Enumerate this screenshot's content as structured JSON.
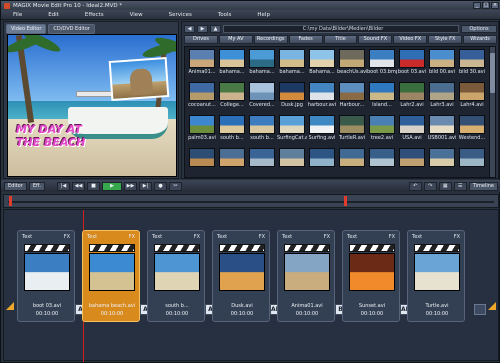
{
  "titlebar": {
    "title": "MAGIX Movie Edit Pro 10 - Ideal2.MVD *"
  },
  "menu": {
    "items": [
      "File",
      "Edit",
      "Effects",
      "View",
      "Services",
      "Tools",
      "Help"
    ]
  },
  "mode_tabs": {
    "video_editor": "Video Editor",
    "cd_dvd_editor": "CD/DVD Editor"
  },
  "preview": {
    "caption_line1": "MY DAY AT",
    "caption_line2": "THE BEACH"
  },
  "browser": {
    "path": "C:\\my Data\\Bilder\\Medien\\Bilder",
    "options_label": "Options",
    "categories": [
      "Drives",
      "My AV",
      "Recordings",
      "Fades",
      "Title",
      "Sound FX",
      "Video FX",
      "Style FX",
      "Wizards"
    ],
    "thumbs": [
      {
        "label": "Anima01...",
        "c1": "#5a7fb0",
        "c2": "#c9a77a"
      },
      {
        "label": "bahama...",
        "c1": "#3d8fd8",
        "c2": "#d9c49a"
      },
      {
        "label": "bahama...",
        "c1": "#4a9bd6",
        "c2": "#2c6b85"
      },
      {
        "label": "bahama...",
        "c1": "#7ab4e0",
        "c2": "#d1bc8a"
      },
      {
        "label": "Bahama...",
        "c1": "#8ec3ea",
        "c2": "#e2d3ad"
      },
      {
        "label": "beachUs.avi",
        "c1": "#6d6a5c",
        "c2": "#c2a777"
      },
      {
        "label": "boot 03.bmp",
        "c1": "#3b7fc2",
        "c2": "#e1e4e8"
      },
      {
        "label": "boot 03.avi",
        "c1": "#2f6db5",
        "c2": "#c92b2b"
      },
      {
        "label": "bild 00.avi",
        "c1": "#4b8ed0",
        "c2": "#cbb085"
      },
      {
        "label": "bild 30.avi",
        "c1": "#365f99",
        "c2": "#c9b693"
      },
      {
        "label": "cocoanut...",
        "c1": "#3f6aa3",
        "c2": "#b59b6b"
      },
      {
        "label": "College...",
        "c1": "#497a45",
        "c2": "#cbb48d"
      },
      {
        "label": "Covered...",
        "c1": "#a9c3dc",
        "c2": "#6d93b9"
      },
      {
        "label": "Dusk.jpg",
        "c1": "#1e3864",
        "c2": "#d28a3b"
      },
      {
        "label": "harbour.avi",
        "c1": "#4285c0",
        "c2": "#dde3e8"
      },
      {
        "label": "Harbour...",
        "c1": "#5c8fbe",
        "c2": "#8a6a44"
      },
      {
        "label": "Island...",
        "c1": "#2f79c0",
        "c2": "#cbb889"
      },
      {
        "label": "Lahr2.avi",
        "c1": "#3a6e3e",
        "c2": "#9b8565"
      },
      {
        "label": "Lahr3.avi",
        "c1": "#4b6d8f",
        "c2": "#b0a488"
      },
      {
        "label": "Lahr4.avi",
        "c1": "#7a5a3a",
        "c2": "#caa46a"
      },
      {
        "label": "palm03.avi",
        "c1": "#3d86d0",
        "c2": "#6c8d3d"
      },
      {
        "label": "south b...",
        "c1": "#2b6fb8",
        "c2": "#dcc99b"
      },
      {
        "label": "south b...",
        "c1": "#3d7dbf",
        "c2": "#d9c8a0"
      },
      {
        "label": "SurfingCat.avi",
        "c1": "#5aa0d8",
        "c2": "#e0d7bd"
      },
      {
        "label": "Surfing.avi",
        "c1": "#3e88c4",
        "c2": "#f0f2f4"
      },
      {
        "label": "TurtleR.avi",
        "c1": "#3a5a4a",
        "c2": "#9c8e62"
      },
      {
        "label": "tree2.avi",
        "c1": "#4a7fb3",
        "c2": "#7a9a4a"
      },
      {
        "label": "USA.avi",
        "c1": "#2f5f9a",
        "c2": "#d6d1c7"
      },
      {
        "label": "USB001.avi",
        "c1": "#6a8ab0",
        "c2": "#e6dcc5"
      },
      {
        "label": "Westend...",
        "c1": "#334f73",
        "c2": "#d7b070"
      },
      {
        "label": "",
        "c1": "#2e4d74",
        "c2": "#b98a52"
      },
      {
        "label": "",
        "c1": "#4c6e94",
        "c2": "#cfa36c"
      },
      {
        "label": "",
        "c1": "#3a6396",
        "c2": "#a6b9c8"
      },
      {
        "label": "",
        "c1": "#5f7f9b",
        "c2": "#d2c3a3"
      },
      {
        "label": "",
        "c1": "#2c5584",
        "c2": "#8fb1c9"
      },
      {
        "label": "",
        "c1": "#406a94",
        "c2": "#c8ad7e"
      },
      {
        "label": "",
        "c1": "#375f8a",
        "c2": "#b0c3d0"
      },
      {
        "label": "",
        "c1": "#2f4f7a",
        "c2": "#c0a070"
      },
      {
        "label": "",
        "c1": "#4a7098",
        "c2": "#d8cbaa"
      },
      {
        "label": "",
        "c1": "#3b5c85",
        "c2": "#9db6c6"
      }
    ]
  },
  "controls": {
    "editor_label": "Editor",
    "effects_label": "Eff.",
    "buttons": [
      "|◀",
      "◀◀",
      "■",
      "▶",
      "▶▶",
      "▶|",
      "●",
      "✂"
    ],
    "timeline_label": "Timeline"
  },
  "storyboard": {
    "clips": [
      {
        "title": "boot 03.avi",
        "time": "00:10:00",
        "c1": "#3b7fc2",
        "c2": "#e9eef3",
        "selected": false
      },
      {
        "title": "bahama beach.avi",
        "time": "00:10:00",
        "c1": "#3b8ad2",
        "c2": "#d5c292",
        "selected": true
      },
      {
        "title": "south b...",
        "time": "00:10:00",
        "c1": "#4d95d3",
        "c2": "#dfd4b4",
        "selected": false
      },
      {
        "title": "Dusk.avi",
        "time": "00:10:00",
        "c1": "#2a4f86",
        "c2": "#e0a24f",
        "selected": false
      },
      {
        "title": "Anima01.avi",
        "time": "00:10:00",
        "c1": "#84a6c4",
        "c2": "#c9ad7e",
        "selected": false
      },
      {
        "title": "Sunset.avi",
        "time": "00:10:00",
        "c1": "#6a2a15",
        "c2": "#f08a2a",
        "selected": false
      },
      {
        "title": "Turtle.avi",
        "time": "00:10:00",
        "c1": "#6aa3d6",
        "c2": "#e7e1d0",
        "selected": false
      }
    ],
    "clip_header": {
      "text": "Text",
      "fx": "FX"
    },
    "transitions": [
      "A",
      "A",
      "A",
      "AB",
      "B",
      "AB"
    ]
  }
}
